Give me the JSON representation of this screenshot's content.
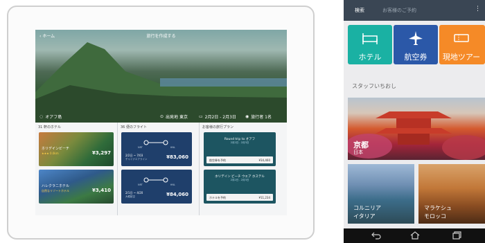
{
  "tablet": {
    "back_label": "ホーム",
    "title": "旅行を作成する",
    "bottom": {
      "place": "オアフ島",
      "origin": "出発地 東京",
      "dates": "2月2日 - 2月3日",
      "people": "旅行者 1名"
    },
    "hotels": {
      "header": "31 軒のホテル",
      "cards": [
        {
          "name": "ホリデインビーチ",
          "sub": "★★★ 0.0km",
          "price": "¥3,297"
        },
        {
          "name": "ハレクラニホテル",
          "sub": "自然なリゾートホテル",
          "price": "¥3,410"
        }
      ]
    },
    "flights": {
      "header": "36 便のフライト",
      "cards": [
        {
          "codes": [
            "NRT",
            "HNL"
          ],
          "date": "2/2日 ~ 7/03",
          "airline": "チャイナエアライン",
          "price": "¥83,060"
        },
        {
          "codes": [
            "NRT",
            "HNL"
          ],
          "date": "2/1日 ~ 4/20",
          "airline": "大韓航空",
          "price": "¥84,060"
        }
      ]
    },
    "plans": {
      "header": "お客様の旅行プラン",
      "cards": [
        {
          "title": "Round trip to オアフ",
          "date": "2月2日 - 2月3日",
          "action": "航空券を予約",
          "price": "¥34,460"
        },
        {
          "title": "ホリデイン ビーチ ウエア ホステル",
          "date": "2月2日 - 2月3日",
          "action": "ホテルを予約",
          "price": "¥11,234"
        }
      ]
    }
  },
  "phone": {
    "tabs": [
      "検索",
      "お客様のご予約"
    ],
    "categories": [
      {
        "label": "ホテル",
        "color": "#1ab1a3"
      },
      {
        "label": "航空券",
        "color": "#2b58a8"
      },
      {
        "label": "現地ツアー",
        "color": "#f58a27"
      }
    ],
    "section_title": "スタッフいちおし",
    "featured": {
      "name": "京都",
      "country": "日本"
    },
    "cities": [
      {
        "name": "コルニリア",
        "country": "イタリア"
      },
      {
        "name": "マラケシュ",
        "country": "モロッコ"
      }
    ]
  }
}
